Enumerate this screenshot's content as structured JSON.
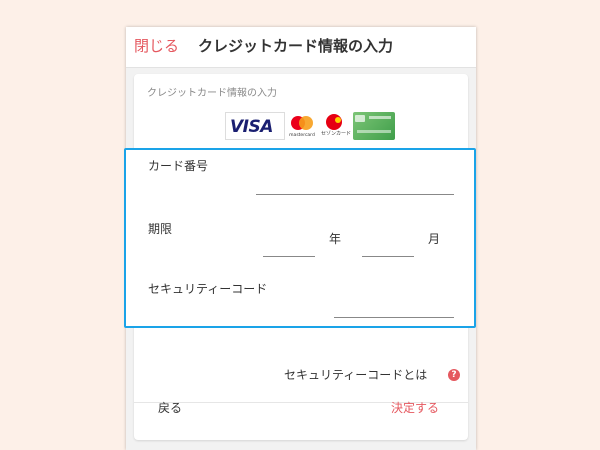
{
  "header": {
    "close_label": "閉じる",
    "title": "クレジットカード情報の入力"
  },
  "card": {
    "section_title": "クレジットカード情報の入力",
    "brands": {
      "visa": "VISA",
      "mastercard": "mastercard",
      "saison": "セゾンカード"
    }
  },
  "form": {
    "card_number_label": "カード番号",
    "card_number_value": "",
    "expiry_label": "期限",
    "expiry_year_value": "",
    "expiry_year_unit": "年",
    "expiry_month_value": "",
    "expiry_month_unit": "月",
    "security_label": "セキュリティーコード",
    "security_value": ""
  },
  "help": {
    "security_help_label": "セキュリティーコードとは",
    "help_icon_glyph": "?"
  },
  "footer": {
    "back_label": "戻る",
    "submit_label": "決定する"
  },
  "colors": {
    "accent": "#e5585f",
    "focus_border": "#1aa3e8",
    "background": "#fdf0e8"
  }
}
